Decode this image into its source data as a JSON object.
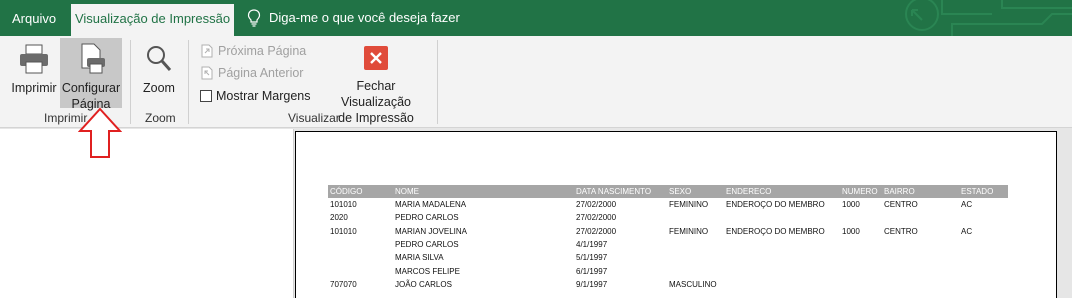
{
  "tabs": {
    "arquivo": "Arquivo",
    "active": "Visualização de Impressão",
    "tell_me": "Diga-me o que você deseja fazer"
  },
  "ribbon": {
    "imprimir": "Imprimir",
    "configurar_l1": "Configurar",
    "configurar_l2": "Página",
    "zoom": "Zoom",
    "proxima": "Próxima Página",
    "anterior": "Página Anterior",
    "mostrar_margens": "Mostrar Margens",
    "fechar_l1": "Fechar Visualização",
    "fechar_l2": "de Impressão",
    "groups": {
      "imprimir": "Imprimir",
      "zoom": "Zoom",
      "visualizar": "Visualizar"
    }
  },
  "colors": {
    "excel_green": "#217346",
    "close_red": "#e04b3a",
    "arrow_red": "#e02020"
  },
  "sheet": {
    "headers": [
      "CÓDIGO",
      "NOME",
      "DATA NASCIMENTO",
      "SEXO",
      "ENDERECO",
      "NUMERO",
      "BAIRRO",
      "ESTADO"
    ],
    "rows": [
      [
        "101010",
        "MARIA MADALENA",
        "27/02/2000",
        "FEMININO",
        "ENDEROÇO DO MEMBRO",
        "1000",
        "CENTRO",
        "AC"
      ],
      [
        "2020",
        "PEDRO CARLOS",
        "27/02/2000",
        "",
        "",
        "",
        "",
        ""
      ],
      [
        "101010",
        "MARIAN JOVELINA",
        "27/02/2000",
        "FEMININO",
        "ENDEROÇO DO MEMBRO",
        "1000",
        "CENTRO",
        "AC"
      ],
      [
        "",
        "PEDRO CARLOS",
        "4/1/1997",
        "",
        "",
        "",
        "",
        ""
      ],
      [
        "",
        "MARIA SILVA",
        "5/1/1997",
        "",
        "",
        "",
        "",
        ""
      ],
      [
        "",
        "MARCOS FELIPE",
        "6/1/1997",
        "",
        "",
        "",
        "",
        ""
      ],
      [
        "707070",
        "JOÃO CARLOS",
        "9/1/1997",
        "MASCULINO",
        "",
        "",
        "",
        ""
      ]
    ]
  }
}
